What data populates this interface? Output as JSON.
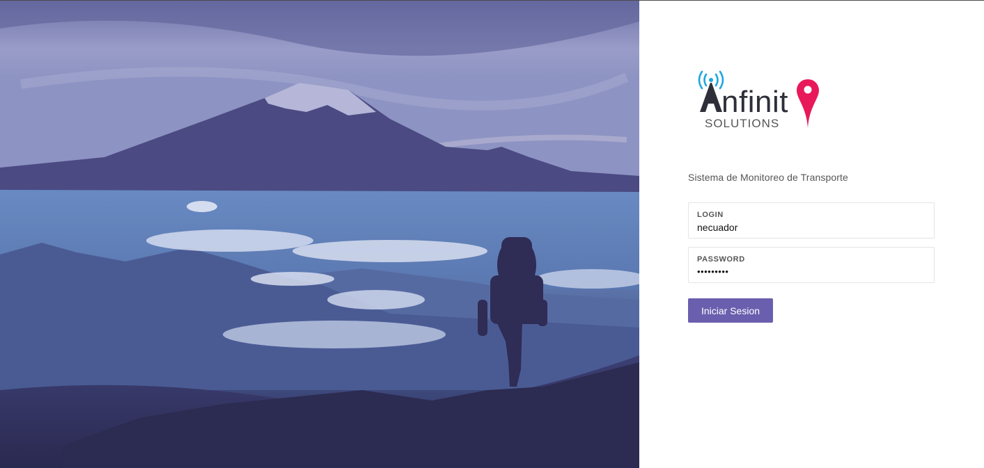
{
  "brand": {
    "logo_text": "Anfinity",
    "logo_subtext": "SOLUTIONS",
    "colors": {
      "logo_dark": "#2f2f3a",
      "logo_signal": "#1ea7e0",
      "logo_pin": "#e8195a",
      "accent": "#6a5fae"
    }
  },
  "hero": {
    "image": "mountain-hiker-photo"
  },
  "login_panel": {
    "subtitle": "Sistema de Monitoreo de Transporte",
    "login_field": {
      "label": "LOGIN",
      "value": "necuador"
    },
    "password_field": {
      "label": "PASSWORD",
      "value": "•••••••••"
    },
    "submit_label": "Iniciar Sesion"
  }
}
